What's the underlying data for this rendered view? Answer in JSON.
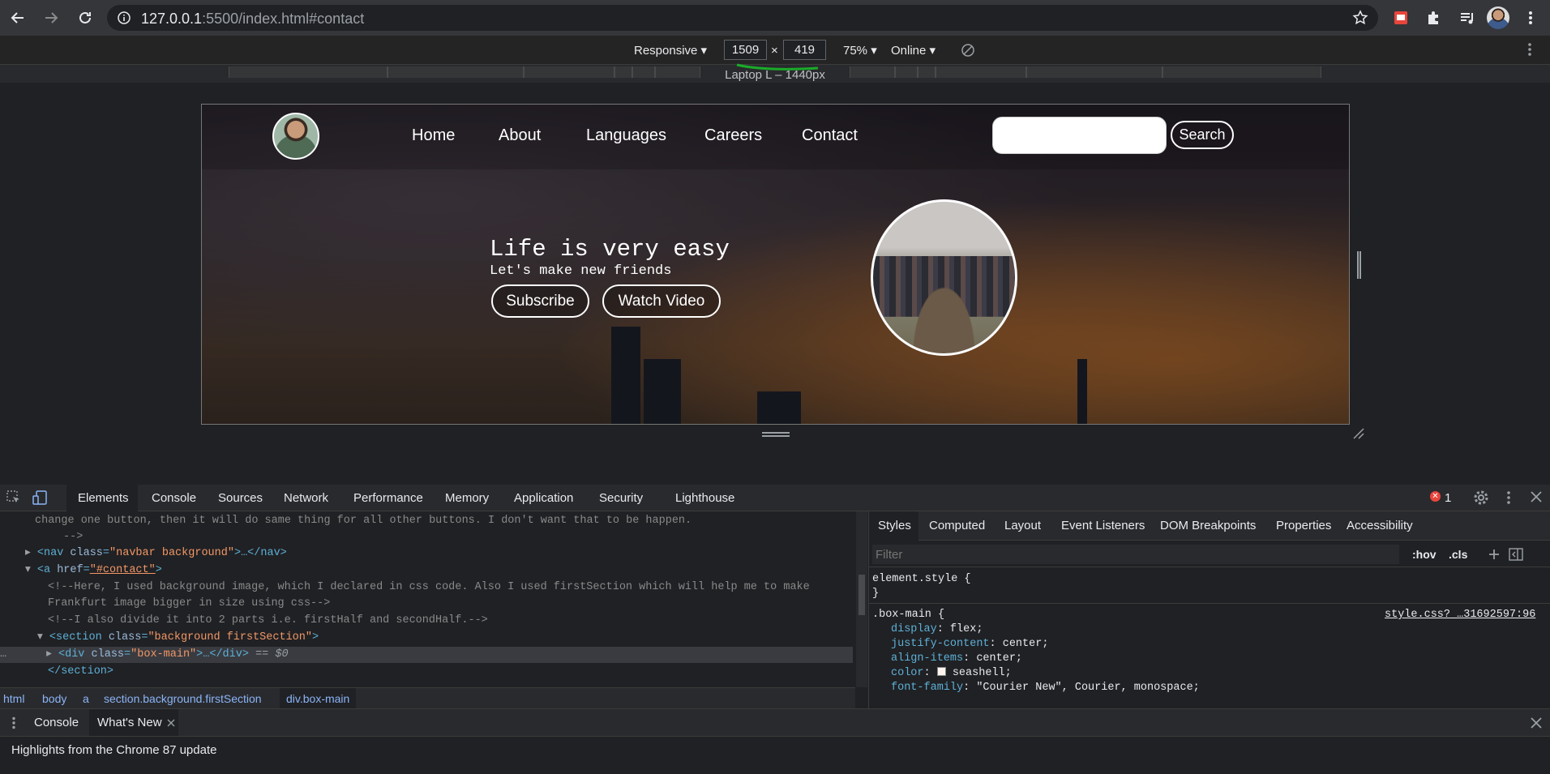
{
  "browser": {
    "url_host": "127.0.0.1",
    "url_rest": ":5500/index.html#contact"
  },
  "device_toolbar": {
    "mode": "Responsive",
    "width": "1509",
    "times": "×",
    "height": "419",
    "zoom": "75%",
    "network": "Online",
    "preset_label": "Laptop L – 1440px"
  },
  "site": {
    "nav_links": [
      "Home",
      "About",
      "Languages",
      "Careers",
      "Contact"
    ],
    "search_button": "Search",
    "search_placeholder": "",
    "hero_title": "Life is very easy",
    "hero_subtitle": "Let's make new friends",
    "subscribe": "Subscribe",
    "watch_video": "Watch Video"
  },
  "devtools": {
    "tabs": [
      "Elements",
      "Console",
      "Sources",
      "Network",
      "Performance",
      "Memory",
      "Application",
      "Security",
      "Lighthouse"
    ],
    "error_count": "1",
    "dom": {
      "line1": "change one button, then it will do same thing for all other buttons. I don't want that to be happen.",
      "line2": "-->",
      "nav_tag": "<nav",
      "nav_attr": "class",
      "nav_val": "\"navbar background\"",
      "nav_rest": ">…</nav>",
      "a_tag": "<a",
      "a_attr": "href",
      "a_val": "\"#contact\"",
      "a_close": ">",
      "comment1a": "<!--Here, I used background image, which I declared in css code. Also I used firstSection which will help me to make",
      "comment1b": "Frankfurt image bigger in size using css-->",
      "comment2": "<!--I also divide it into 2 parts i.e. firstHalf and secondHalf.-->",
      "section_tag": "<section",
      "section_attr": "class",
      "section_val": "\"background firstSection\"",
      "section_close": ">",
      "div_tag": "<div",
      "div_attr": "class",
      "div_val": "\"box-main\"",
      "div_rest": ">…</div>",
      "div_eq": "== $0",
      "section_end": "</section>"
    },
    "breadcrumbs": [
      "html",
      "body",
      "a",
      "section.background.firstSection",
      "div.box-main"
    ],
    "styles_tabs": [
      "Styles",
      "Computed",
      "Layout",
      "Event Listeners",
      "DOM Breakpoints",
      "Properties",
      "Accessibility"
    ],
    "filter_placeholder": "Filter",
    "hov": ":hov",
    "cls": ".cls",
    "css": {
      "element_style": "element.style {",
      "close": "}",
      "selector": ".box-main {",
      "source": "style.css?_…31692597:96",
      "decls": [
        {
          "prop": "display",
          "val": "flex;"
        },
        {
          "prop": "justify-content",
          "val": "center;"
        },
        {
          "prop": "align-items",
          "val": "center;"
        },
        {
          "prop": "color",
          "val": "seashell;"
        },
        {
          "prop": "font-family",
          "val": "\"Courier New\", Courier, monospace;"
        }
      ]
    },
    "drawer_tabs": [
      "Console",
      "What's New"
    ],
    "drawer_text": "Highlights from the Chrome 87 update"
  },
  "colors": {
    "chrome_bg": "#35363a",
    "devtools_bg": "#202124",
    "link_blue": "#8ab4f8",
    "error_red": "#e8453c",
    "accent_green": "#1aab29"
  }
}
